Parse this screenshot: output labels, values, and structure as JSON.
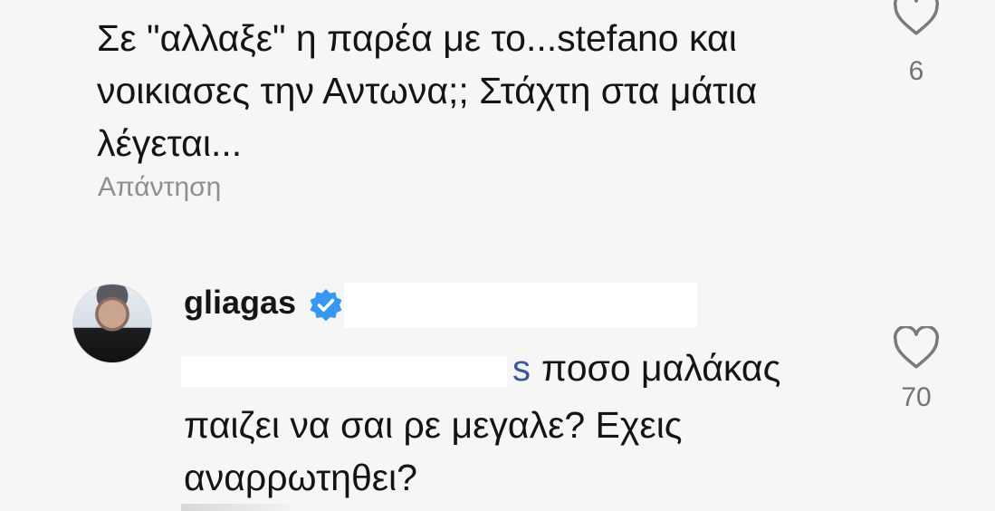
{
  "comment1": {
    "text": "Σε \"αλλαξε\" η παρέα με το...stefano και\nνοικιασες την Αντωνα;; Στάχτη στα μάτια\nλέγεται...",
    "reply_label": "Απάντηση",
    "like_count": "6",
    "like_icon": "heart-outline-icon"
  },
  "comment2": {
    "username": "gliagas",
    "verified_icon": "verified-badge-icon",
    "mention_fragment": "s",
    "text_line1": "ποσο μαλάκας",
    "text_rest": "παιζει να σαι ρε μεγαλε? Εχεις\nαναρρωτηθει?",
    "like_count": "70",
    "like_icon": "heart-outline-icon"
  },
  "colors": {
    "verified_blue": "#3897f0",
    "mention_blue": "#3b5998",
    "secondary_text": "#8e8e8e"
  }
}
